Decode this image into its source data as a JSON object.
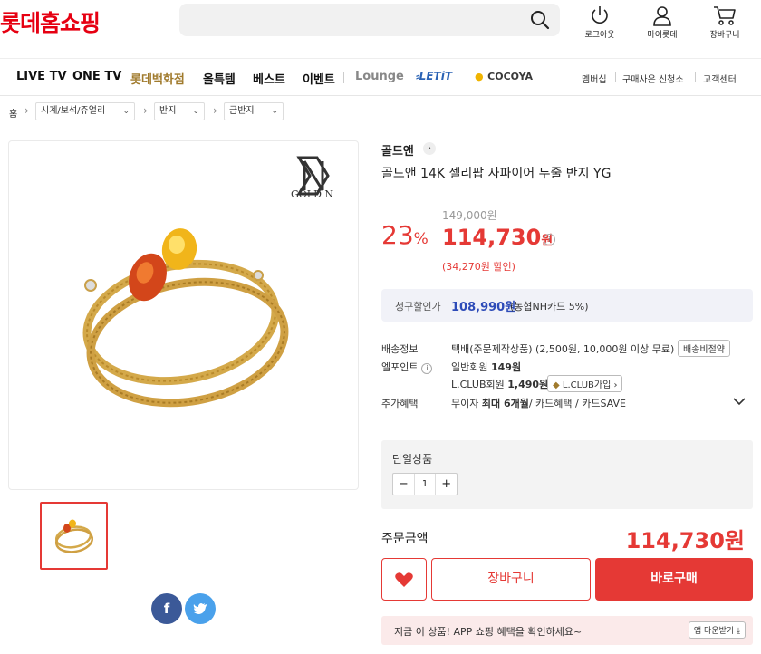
{
  "header": {
    "logo": "롯데홈쇼핑",
    "search_placeholder": "",
    "icons": [
      {
        "name": "power-icon",
        "label": "로그아웃"
      },
      {
        "name": "person-icon",
        "label": "마이롯데"
      },
      {
        "name": "cart-icon",
        "label": "장바구니"
      }
    ]
  },
  "nav": {
    "items": [
      "LIVE TV",
      "ONE TV",
      "롯데백화점",
      "올특템",
      "베스트",
      "이벤트"
    ],
    "lounge": "Lounge",
    "letit": "LETiT",
    "cocoya": "COCOYA",
    "util": [
      "멤버십",
      "구매사은 신청소",
      "고객센터"
    ]
  },
  "breadcrumb": {
    "home": "홈",
    "levels": [
      "시계/보석/쥬얼리",
      "반지",
      "금반지"
    ]
  },
  "product": {
    "image_brand_text": "GOLD N",
    "brand": "골드앤",
    "title": "골드앤 14K 젤리팝 사파이어 두줄 반지 YG",
    "discount_rate": "23",
    "discount_unit": "%",
    "original_price": "149,000원",
    "price": "114,730",
    "price_unit": "원",
    "save_text": "(34,270원 할인)",
    "card_discount": {
      "label": "청구할인가",
      "value": "108,990원",
      "card": "(농협NH카드 5%)"
    },
    "shipping": {
      "label": "배송정보",
      "value": "택배(주문제작상품) (2,500원, 10,000원 이상 무료)",
      "button": "배송비절약"
    },
    "points": {
      "label": "엘포인트",
      "regular_label": "일반회원",
      "regular_value": "149원",
      "club_label": "L.CLUB회원",
      "club_value": "1,490원",
      "club_button": "L.CLUB가입"
    },
    "benefits": {
      "label": "추가혜택",
      "prefix": "무이자",
      "strong": "최대 6개월",
      "rest": "/ 카드혜택 / 카드SAVE"
    },
    "option": {
      "label": "단일상품",
      "quantity": "1"
    },
    "total": {
      "label": "주문금액",
      "value": "114,730원"
    },
    "buttons": {
      "cart": "장바구니",
      "buy": "바로구매"
    },
    "app_bar": {
      "text": "지금 이 상품! APP 쇼핑 혜택을 확인하세요~",
      "button": "앱 다운받기"
    }
  },
  "colors": {
    "accent": "#e53935",
    "logo": "#e60012",
    "card_value": "#2d4bb8",
    "gold": "#a07a2c"
  }
}
